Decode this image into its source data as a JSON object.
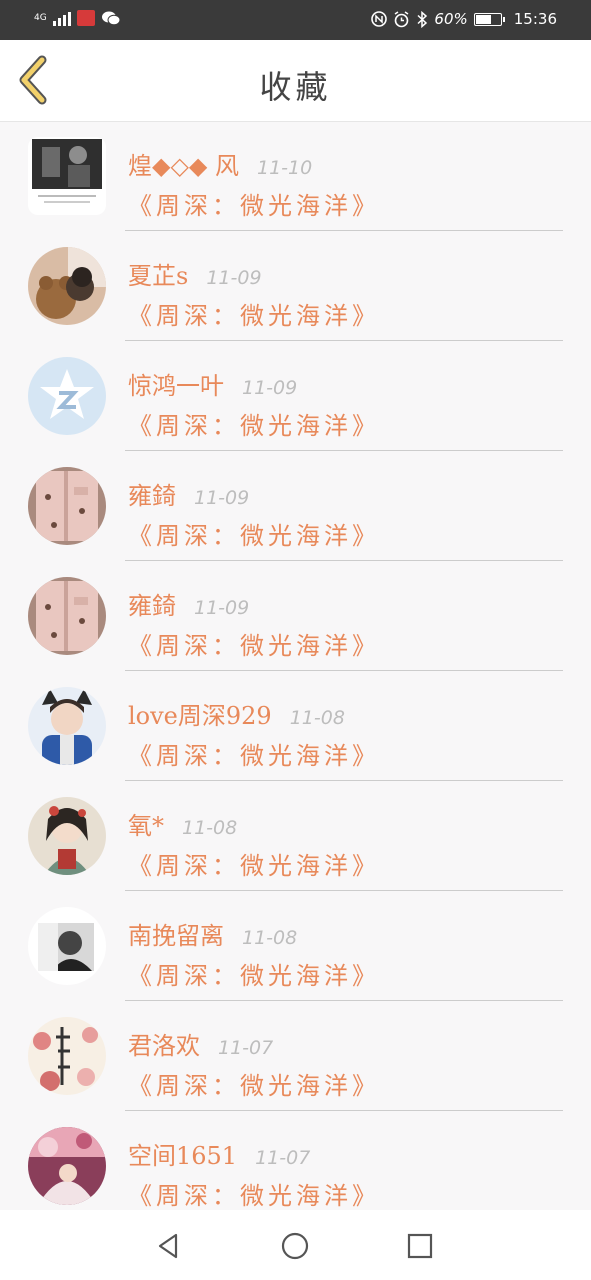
{
  "status_bar": {
    "network": "4G",
    "battery": "60%",
    "battery_level": 0.6,
    "time": "15:36",
    "icons": [
      "signal-icon",
      "app-notification-icon",
      "wechat-icon",
      "nfc-icon",
      "alarm-icon",
      "bluetooth-icon",
      "battery-icon"
    ]
  },
  "header": {
    "title": "收藏",
    "back_icon": "chevron-left-icon"
  },
  "favorites": [
    {
      "name": "煌◆◇◆ 风",
      "date": "11-10",
      "book": "《周深：微光海洋》",
      "avatar_style": "square-photo"
    },
    {
      "name": "夏芷s",
      "date": "11-09",
      "book": "《周深：微光海洋》",
      "avatar_style": "photo-bear"
    },
    {
      "name": "惊鸿一叶",
      "date": "11-09",
      "book": "《周深：微光海洋》",
      "avatar_style": "qq-default"
    },
    {
      "name": "雍錡",
      "date": "11-09",
      "book": "《周深：微光海洋》",
      "avatar_style": "photo-clothes"
    },
    {
      "name": "雍錡",
      "date": "11-09",
      "book": "《周深：微光海洋》",
      "avatar_style": "photo-clothes"
    },
    {
      "name": "love周深929",
      "date": "11-08",
      "book": "《周深：微光海洋》",
      "avatar_style": "photo-cat-ears"
    },
    {
      "name": "氧*",
      "date": "11-08",
      "book": "《周深：微光海洋》",
      "avatar_style": "painting"
    },
    {
      "name": "南挽留离",
      "date": "11-08",
      "book": "《周深：微光海洋》",
      "avatar_style": "photo-bw"
    },
    {
      "name": "君洛欢",
      "date": "11-07",
      "book": "《周深：微光海洋》",
      "avatar_style": "calligraphy-flowers"
    },
    {
      "name": "空间1651",
      "date": "11-07",
      "book": "《周深：微光海洋》",
      "avatar_style": "illustration"
    }
  ],
  "nav_bar": {
    "back": "triangle-back-icon",
    "home": "circle-home-icon",
    "recents": "square-recents-icon"
  },
  "colors": {
    "accent": "#e8895a",
    "date": "#bdbdbd",
    "back_chevron_fill": "#f2d16b",
    "back_chevron_stroke": "#555555"
  }
}
